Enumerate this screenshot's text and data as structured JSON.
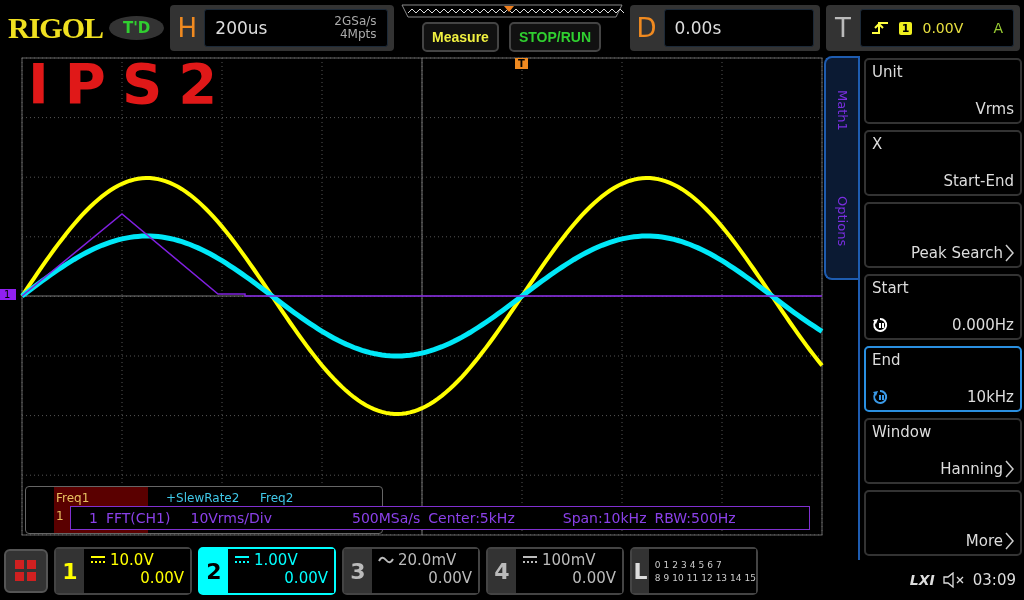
{
  "logo": "RIGOL",
  "mode_badge": "T'D",
  "annotation": "IPS2",
  "horizontal": {
    "label": "H",
    "timebase": "200us",
    "sample_rate": "2GSa/s",
    "memory_depth": "4Mpts"
  },
  "buttons": [
    {
      "label": "Measure",
      "kind": "measure"
    },
    {
      "label": "STOP/RUN",
      "kind": "run"
    }
  ],
  "delay": {
    "label": "D",
    "value": "0.00s"
  },
  "trigger": {
    "label": "T",
    "source": "1",
    "level": "0.00V",
    "mode": "A"
  },
  "trigger_marker": "T",
  "ref_marker": "1",
  "side_tabs": [
    {
      "label": "Math1"
    },
    {
      "label": "Options"
    }
  ],
  "menu": [
    {
      "label": "Unit",
      "value": "Vrms",
      "arrow": false,
      "knob": false,
      "selected": false
    },
    {
      "label": "X",
      "value": "Start-End",
      "arrow": false,
      "knob": false,
      "selected": false
    },
    {
      "value": "Peak Search",
      "arrow": true,
      "knob": false,
      "selected": false
    },
    {
      "label": "Start",
      "value": "0.000Hz",
      "arrow": false,
      "knob": true,
      "selected": false
    },
    {
      "label": "End",
      "value": "10kHz",
      "arrow": false,
      "knob": true,
      "selected": true
    },
    {
      "label": "Window",
      "value": "Hanning",
      "arrow": true,
      "knob": false,
      "selected": false
    },
    {
      "value": "More",
      "arrow": true,
      "knob": false,
      "selected": false
    }
  ],
  "measurements": [
    {
      "label": "Freq1",
      "value": "1",
      "color": "#e8c060",
      "selected": true
    },
    {
      "label": "+SlewRate2",
      "color": "#40c8e8",
      "selected": false
    },
    {
      "label": "Freq2",
      "color": "#40c8e8",
      "selected": false
    }
  ],
  "fft_info": {
    "channel": "1",
    "source": "FFT(CH1)",
    "scale": "10Vrms/Div",
    "sample_rate": "500MSa/s",
    "center": "Center:5kHz",
    "span": "Span:10kHz",
    "rbw": "RBW:500Hz"
  },
  "channels": [
    {
      "number": "1",
      "scale": "10.0V",
      "offset": "0.00V",
      "kind": "dc",
      "color": "#ffff00",
      "selected": false
    },
    {
      "number": "2",
      "scale": "1.00V",
      "offset": "0.00V",
      "kind": "dc",
      "color": "#00ffff",
      "selected": true
    },
    {
      "number": "3",
      "scale": "20.0mV",
      "offset": "0.00V",
      "kind": "ac",
      "color": "#bbbbbb",
      "selected": false
    },
    {
      "number": "4",
      "scale": "100mV",
      "offset": "0.00V",
      "kind": "dc",
      "color": "#bbbbbb",
      "selected": false
    }
  ],
  "logic": {
    "label": "L",
    "row_1": [
      "0",
      "1",
      "2",
      "3",
      "4",
      "5",
      "6",
      "7"
    ],
    "row_2": [
      "8",
      "9",
      "10",
      "11",
      "12",
      "13",
      "14",
      "15"
    ]
  },
  "status": {
    "lxi": "LXI",
    "time": "03:09"
  }
}
